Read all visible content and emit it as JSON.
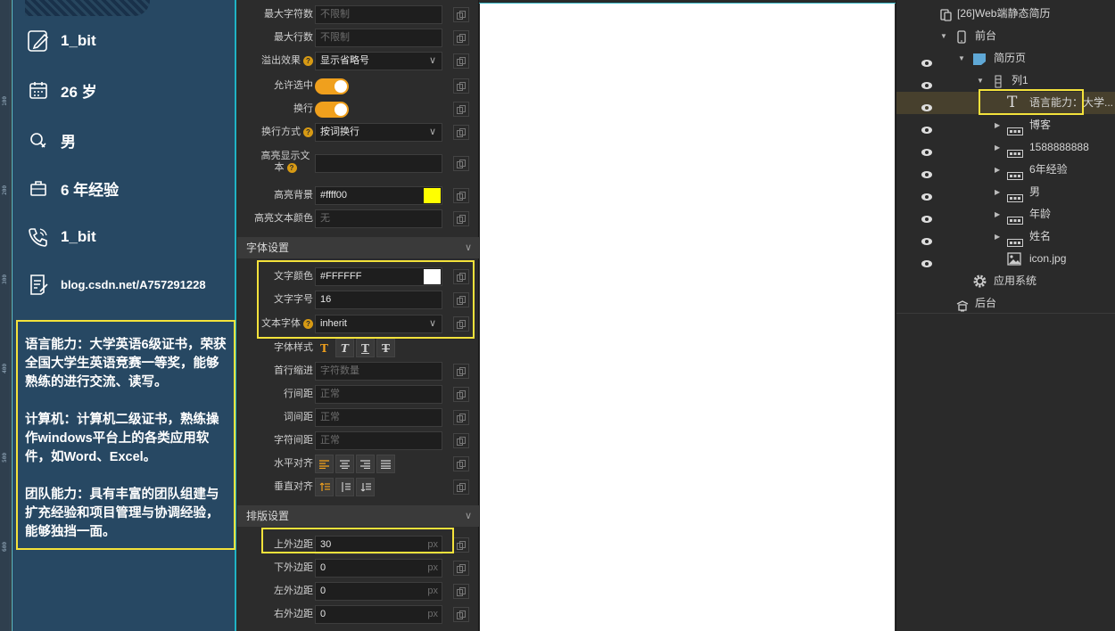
{
  "preview": {
    "ruler_ticks": [
      "100",
      "200",
      "300",
      "400",
      "500",
      "600"
    ],
    "info": [
      {
        "icon": "pencil-icon",
        "text": "1_bit"
      },
      {
        "icon": "calendar-icon",
        "text": "26 岁"
      },
      {
        "icon": "gender-icon",
        "text": "男"
      },
      {
        "icon": "briefcase-icon",
        "text": "6 年经验"
      },
      {
        "icon": "phone-icon",
        "text": "1_bit"
      },
      {
        "icon": "document-icon",
        "text": "blog.csdn.net/A757291228"
      }
    ],
    "lang_block": "语言能力：大学英语6级证书，荣获全国大学生英语竞赛一等奖，能够熟练的进行交流、读写。\n\n计算机：计算机二级证书，熟练操作windows平台上的各类应用软件，如Word、Excel。\n\n团队能力：具有丰富的团队组建与扩充经验和项目管理与协调经验，能够独挡一面。"
  },
  "props": {
    "max_chars": {
      "label": "最大字符数",
      "placeholder": "不限制"
    },
    "max_lines": {
      "label": "最大行数",
      "placeholder": "不限制"
    },
    "overflow": {
      "label": "溢出效果",
      "value": "显示省略号"
    },
    "allow_select": {
      "label": "允许选中"
    },
    "wrap": {
      "label": "换行"
    },
    "wrap_mode": {
      "label": "换行方式",
      "value": "按词换行"
    },
    "highlight_text": {
      "label": "高亮显示文本"
    },
    "highlight_bg": {
      "label": "高亮背景",
      "value": "#ffff00",
      "color": "#ffff00"
    },
    "highlight_color": {
      "label": "高亮文本颜色",
      "placeholder": "无"
    },
    "font_section": "字体设置",
    "text_color": {
      "label": "文字颜色",
      "value": "#FFFFFF",
      "color": "#ffffff"
    },
    "font_size": {
      "label": "文字字号",
      "value": "16"
    },
    "font_family": {
      "label": "文本字体",
      "value": "inherit"
    },
    "font_style": {
      "label": "字体样式"
    },
    "indent": {
      "label": "首行缩进",
      "placeholder": "字符数量"
    },
    "line_height": {
      "label": "行间距",
      "placeholder": "正常"
    },
    "word_spacing": {
      "label": "词间距",
      "placeholder": "正常"
    },
    "letter_spacing": {
      "label": "字符间距",
      "placeholder": "正常"
    },
    "h_align": {
      "label": "水平对齐"
    },
    "v_align": {
      "label": "垂直对齐"
    },
    "layout_section": "排版设置",
    "margin_top": {
      "label": "上外边距",
      "value": "30",
      "unit": "px"
    },
    "margin_bottom": {
      "label": "下外边距",
      "value": "0",
      "unit": "px"
    },
    "margin_left": {
      "label": "左外边距",
      "value": "0",
      "unit": "px"
    },
    "margin_right": {
      "label": "右外边距",
      "value": "0",
      "unit": "px"
    }
  },
  "tree": {
    "project": "[26]Web端静态简历",
    "frontend": "前台",
    "page": "简历页",
    "column": "列1",
    "selected": "语言能力：大学...",
    "items": [
      "博客",
      "1588888888",
      "6年经验",
      "男",
      "年龄",
      "姓名"
    ],
    "image": "icon.jpg",
    "app_system": "应用系统",
    "backend": "后台"
  },
  "colors": {
    "accent": "#f0a01d",
    "highlight_box": "#f4e23b",
    "resume_bg": "#274863"
  }
}
